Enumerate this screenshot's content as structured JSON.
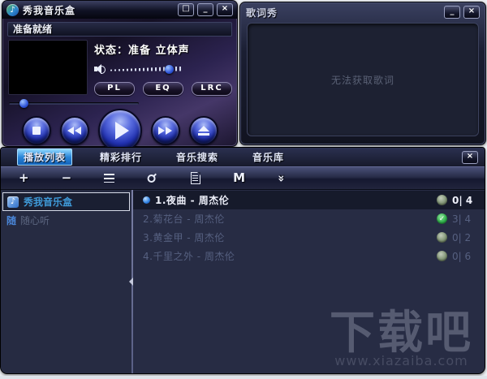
{
  "player": {
    "title": "秀我音乐盒",
    "ready_text": "准备就绪",
    "status_label": "状态：",
    "status_value": "准备",
    "channel": "立体声",
    "btn_pl": "PL",
    "btn_eq": "EQ",
    "btn_lrc": "LRC",
    "volume_percent": 76,
    "progress_percent": 8,
    "win": {
      "restore": "□",
      "minimize": "_",
      "close": "×"
    }
  },
  "lyrics": {
    "title": "歌词秀",
    "message": "无法获取歌词",
    "win": {
      "minimize": "_",
      "close": "×"
    }
  },
  "panel": {
    "close_glyph": "×",
    "tabs": [
      {
        "label": "播放列表",
        "active": true
      },
      {
        "label": "精彩排行",
        "active": false
      },
      {
        "label": "音乐搜索",
        "active": false
      },
      {
        "label": "音乐库",
        "active": false
      }
    ],
    "toolbar_icons": [
      {
        "name": "add-icon",
        "glyph": "+",
        "css": ""
      },
      {
        "name": "remove-icon",
        "glyph": "−",
        "css": ""
      },
      {
        "name": "playlist-icon",
        "glyph": "",
        "css": "ic-list"
      },
      {
        "name": "key-icon",
        "glyph": "",
        "css": "ic-key"
      },
      {
        "name": "file-icon",
        "glyph": "",
        "css": "ic-file"
      },
      {
        "name": "m-icon",
        "glyph": "M",
        "css": ""
      },
      {
        "name": "collapse-icon",
        "glyph": "«",
        "css": "ic-rot"
      }
    ],
    "sidebar": [
      {
        "label": "秀我音乐盒",
        "selected": true,
        "icon": "music-note"
      },
      {
        "label": "随心听",
        "selected": false,
        "prefix": "随"
      }
    ],
    "playlist": [
      {
        "title": "1.夜曲 - 周杰伦",
        "selected": true,
        "badge": "idle",
        "count": "0| 4"
      },
      {
        "title": "2.菊花台 - 周杰伦",
        "selected": false,
        "badge": "check",
        "count": "3| 4"
      },
      {
        "title": "3.黄金甲 - 周杰伦",
        "selected": false,
        "badge": "idle",
        "count": "0| 2"
      },
      {
        "title": "4.千里之外 - 周杰伦",
        "selected": false,
        "badge": "idle",
        "count": "0| 6"
      }
    ]
  },
  "watermark": {
    "text": "下载吧",
    "url": "www.xiazaiba.com"
  },
  "colors": {
    "tab_active": "#2a86d8",
    "selected_song_text": "#eef0fa",
    "muted_text": "#5c6680",
    "sidebar_selected_text": "#3f9ad8",
    "badge_check_green": "#2eb04a",
    "badge_idle": "#7e9272",
    "button_blue": "#2030b0"
  }
}
